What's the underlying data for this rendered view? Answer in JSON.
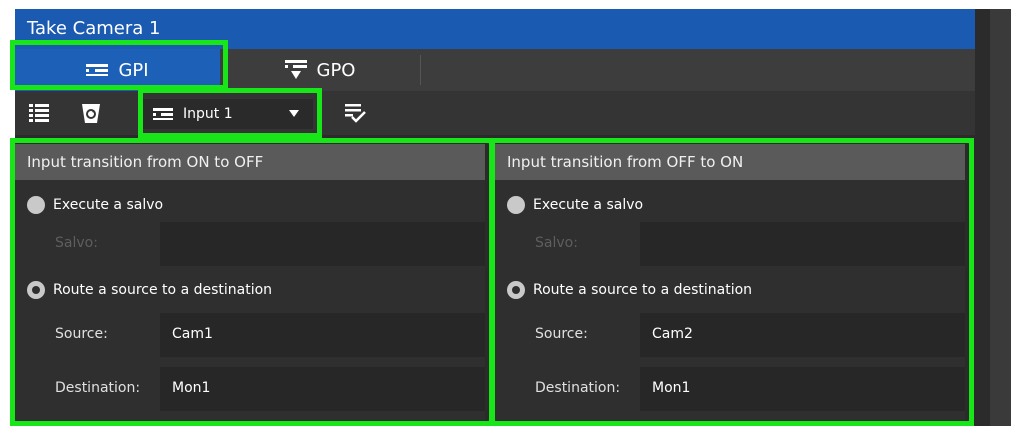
{
  "window": {
    "title": "Take Camera 1"
  },
  "tabs": [
    {
      "label": "GPI",
      "icon": "gpi-icon",
      "active": true
    },
    {
      "label": "GPO",
      "icon": "gpo-icon",
      "active": false
    }
  ],
  "toolbar": {
    "list_icon": "list-icon",
    "clear_icon": "bucket-icon",
    "input_select": {
      "value": "Input 1",
      "icon": "gpi-icon"
    },
    "apply_icon": "apply-check-icon"
  },
  "panels": [
    {
      "title": "Input transition from ON to OFF",
      "option_salvo": "Execute a salvo",
      "salvo_label": "Salvo:",
      "salvo_value": "",
      "option_route": "Route a source to a destination",
      "source_label": "Source:",
      "source_value": "Cam1",
      "destination_label": "Destination:",
      "destination_value": "Mon1",
      "selected": "route"
    },
    {
      "title": "Input transition from OFF to ON",
      "option_salvo": "Execute a salvo",
      "salvo_label": "Salvo:",
      "salvo_value": "",
      "option_route": "Route a source to a destination",
      "source_label": "Source:",
      "source_value": "Cam2",
      "destination_label": "Destination:",
      "destination_value": "Mon1",
      "selected": "route"
    }
  ],
  "colors": {
    "title_bar": "#1a5ab0",
    "active_tab": "#1d60b8",
    "highlight": "#19e619"
  }
}
